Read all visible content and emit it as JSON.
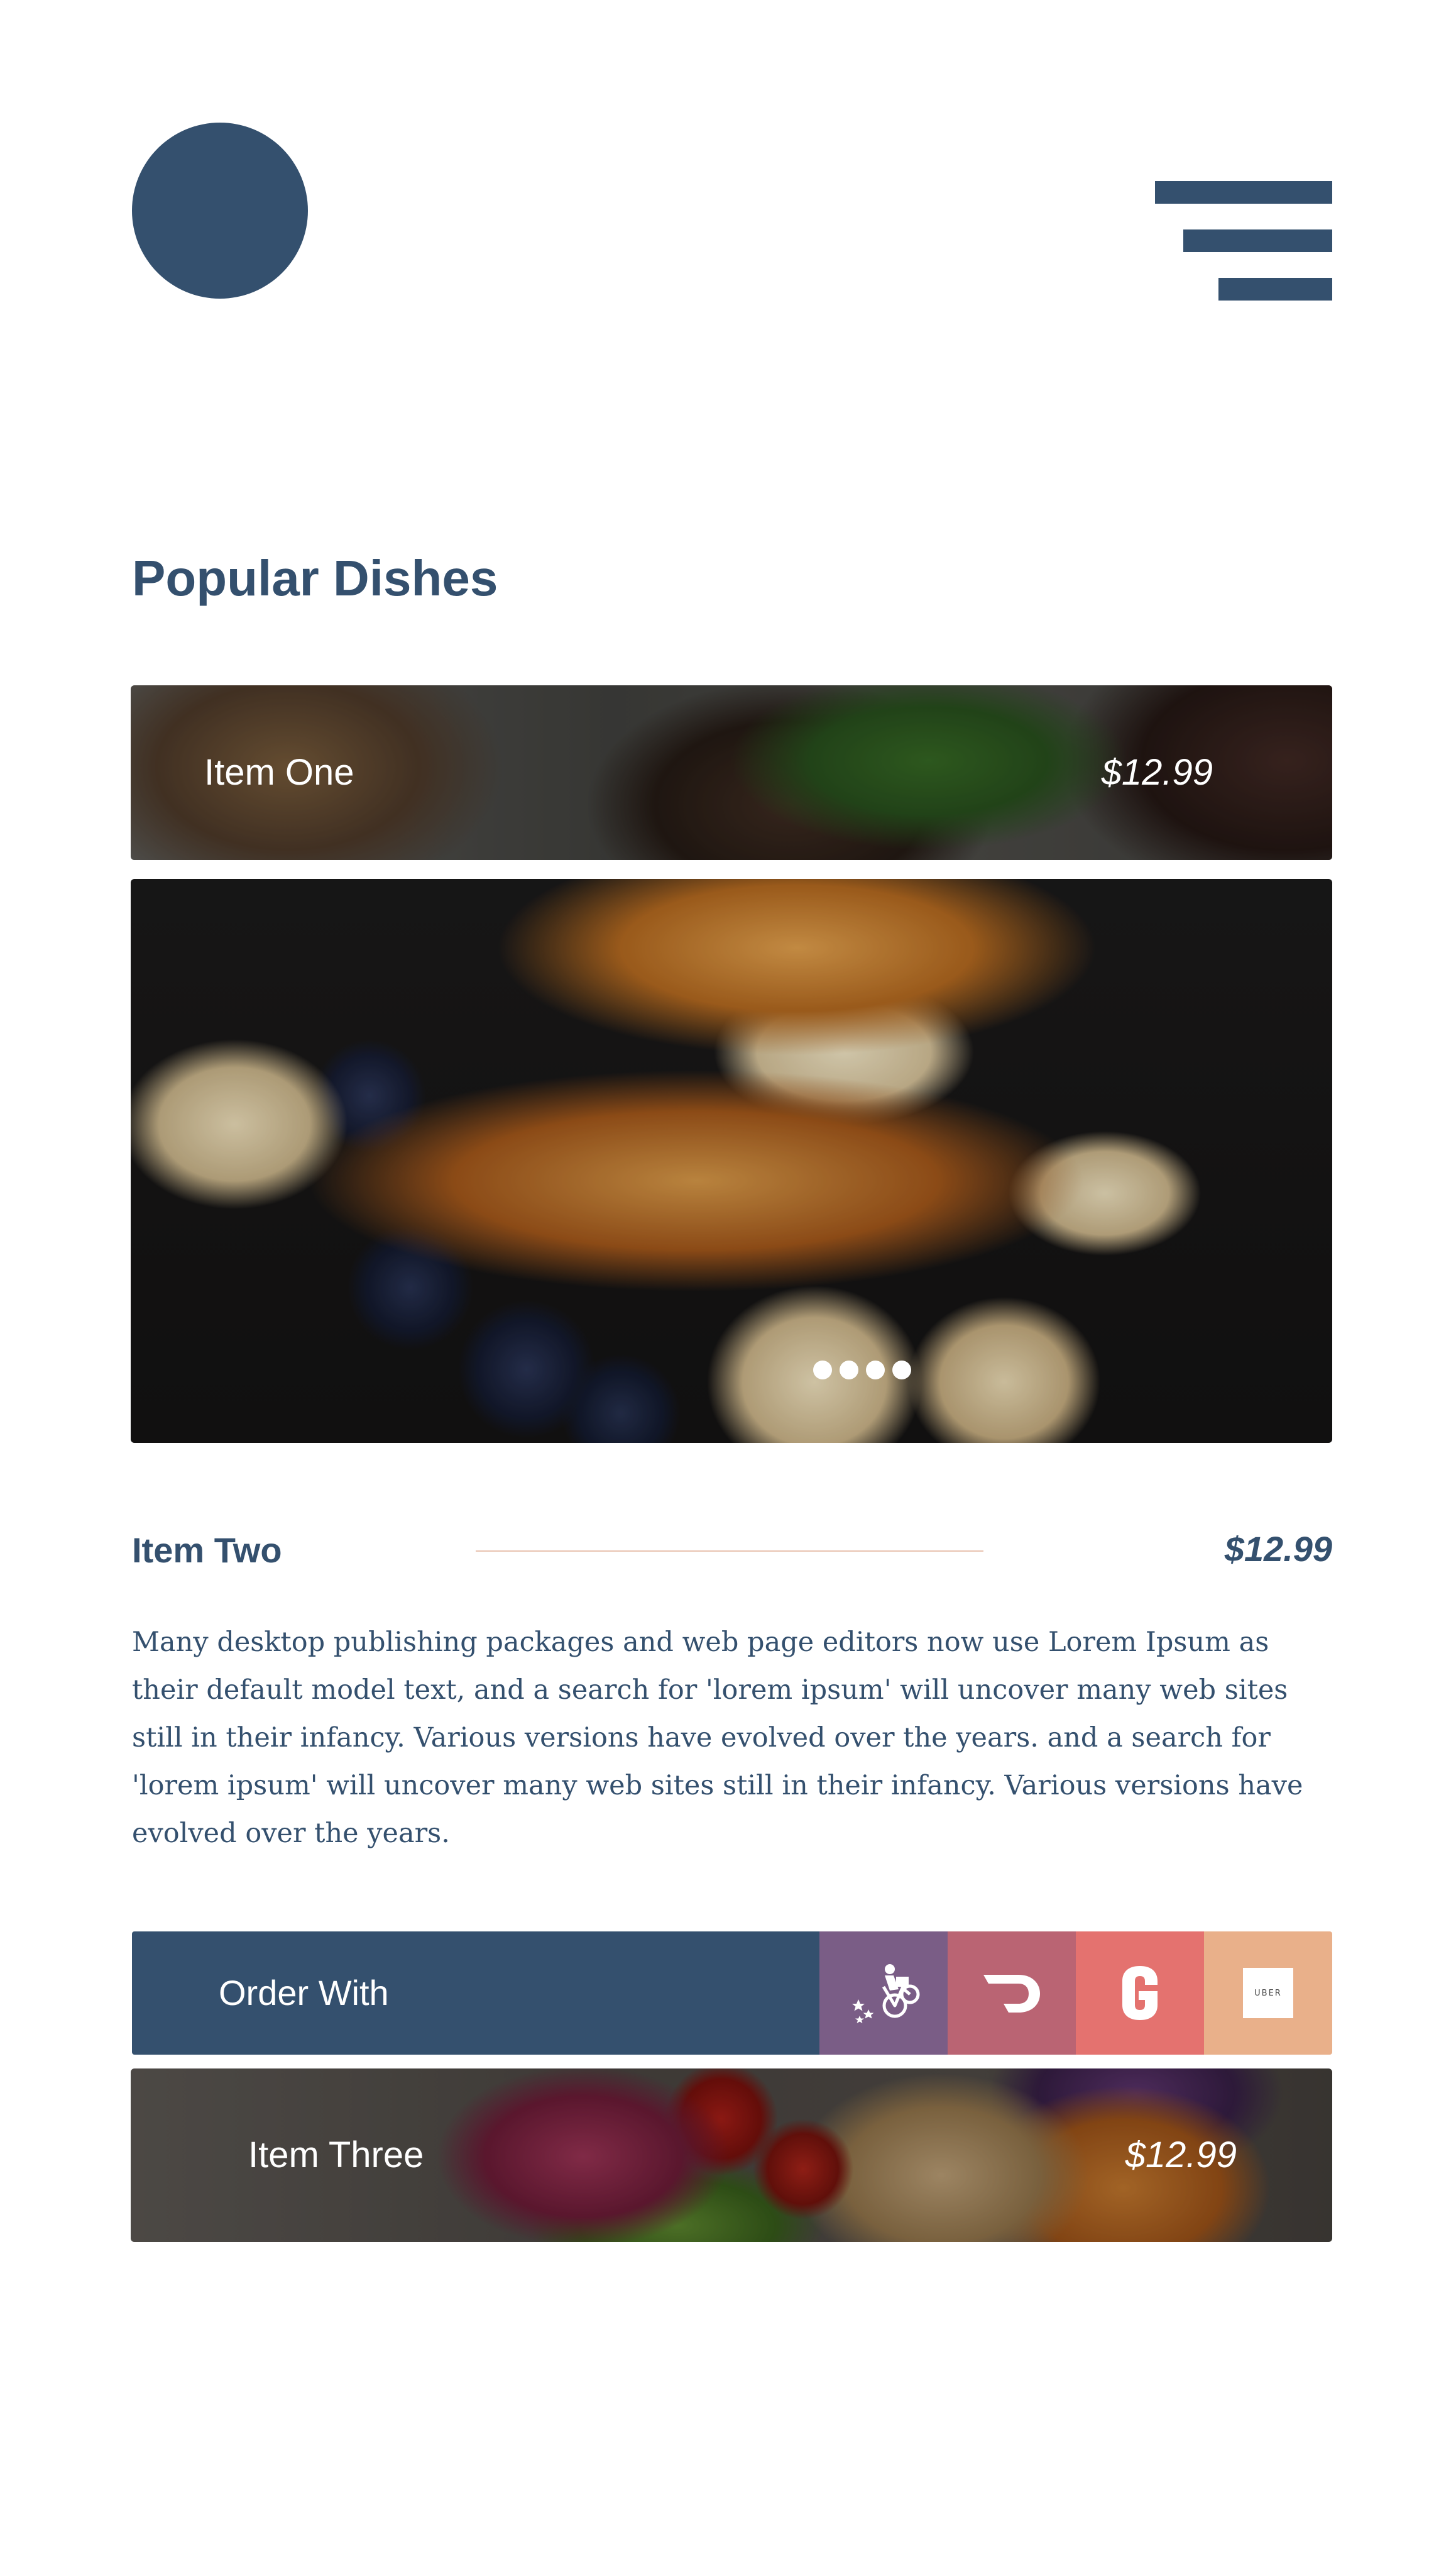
{
  "header": {
    "logo_icon": "circle-logo",
    "menu_icon": "hamburger-menu-icon"
  },
  "section": {
    "title": "Popular Dishes"
  },
  "items": [
    {
      "name": "Item One",
      "price": "$12.99"
    },
    {
      "name": "Item Two",
      "price": "$12.99",
      "description": "Many desktop publishing packages and web page editors now use Lorem Ipsum as their default model text, and a search for 'lorem ipsum' will uncover many web sites still in their infancy. Various versions have evolved over the years. and a search for 'lorem ipsum' will uncover many web sites still in their infancy. Various versions have evolved over the years."
    },
    {
      "name": "Item Three",
      "price": "$12.99"
    }
  ],
  "carousel": {
    "dot_count": 4
  },
  "order": {
    "label": "Order With",
    "services": [
      {
        "icon": "postmates-icon",
        "color": "#7a5d86"
      },
      {
        "icon": "doordash-icon",
        "color": "#ba6473"
      },
      {
        "icon": "grubhub-icon",
        "color": "#e4726f"
      },
      {
        "icon": "uber-eats-icon",
        "color": "#e9b08a",
        "tile_text": "UBER"
      }
    ]
  },
  "colors": {
    "primary": "#34506e",
    "divider": "#e8c3b0"
  }
}
